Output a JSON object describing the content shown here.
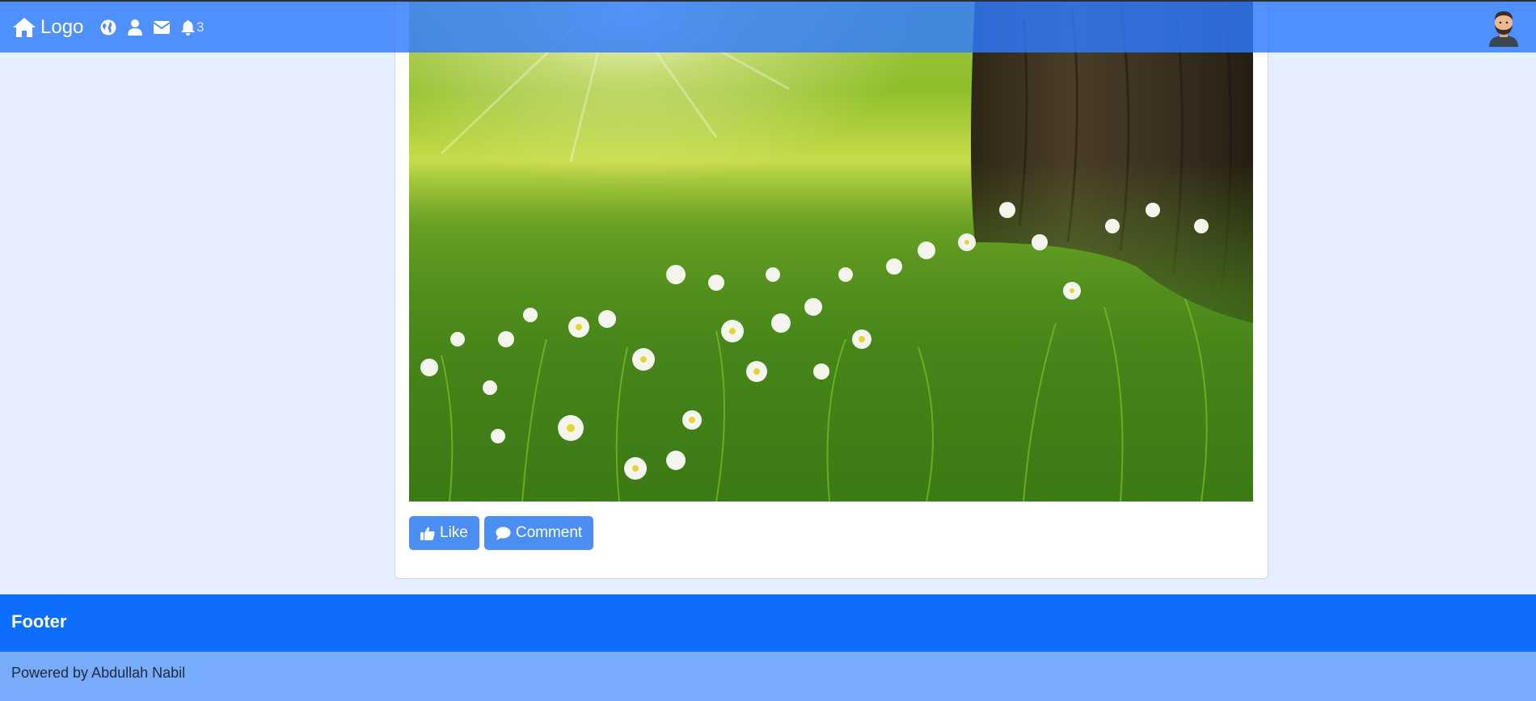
{
  "nav": {
    "brand_label": "Logo",
    "notification_count": "3",
    "icons": [
      "home-icon",
      "globe-icon",
      "user-icon",
      "envelope-icon",
      "bell-icon"
    ],
    "bar_color": "#2e7bff"
  },
  "post": {
    "like_label": "Like",
    "comment_label": "Comment",
    "button_color": "#4b8ff5"
  },
  "footer": {
    "title": "Footer",
    "credit": "Powered by Abdullah Nabil",
    "primary_color": "#0d6efd",
    "secondary_color": "#78abf9"
  }
}
